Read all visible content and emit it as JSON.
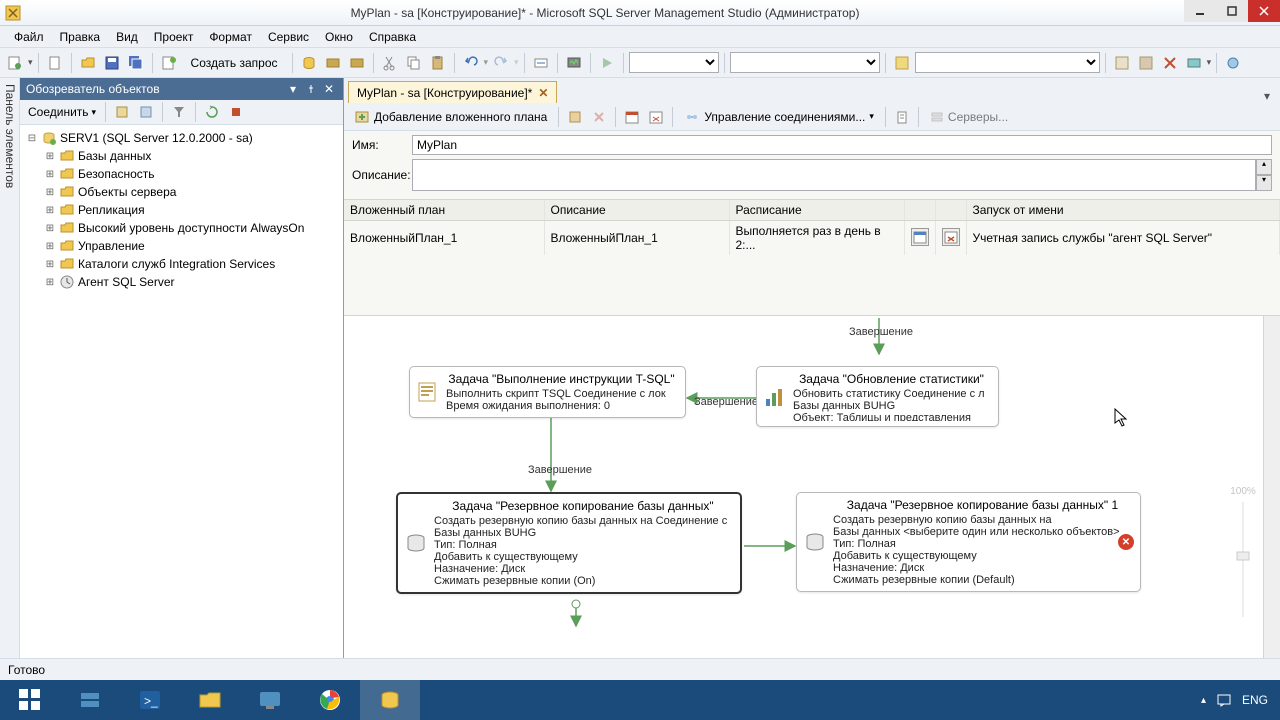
{
  "window": {
    "title": "MyPlan - sa [Конструирование]* - Microsoft SQL Server Management Studio (Администратор)"
  },
  "menu": {
    "items": [
      "Файл",
      "Правка",
      "Вид",
      "Проект",
      "Формат",
      "Сервис",
      "Окно",
      "Справка"
    ]
  },
  "toolbar": {
    "new_query": "Создать запрос"
  },
  "side_tab": "Панель элементов",
  "objexp": {
    "title": "Обозреватель объектов",
    "connect": "Соединить",
    "root": "SERV1 (SQL Server 12.0.2000 - sa)",
    "nodes": [
      "Базы данных",
      "Безопасность",
      "Объекты сервера",
      "Репликация",
      "Высокий уровень доступности AlwaysOn",
      "Управление",
      "Каталоги служб Integration Services",
      "Агент SQL Server"
    ]
  },
  "tab": {
    "label": "MyPlan - sa [Конструирование]*"
  },
  "plan_toolbar": {
    "add_subplan": "Добавление вложенного плана",
    "manage_conn": "Управление соединениями...",
    "servers": "Серверы..."
  },
  "form": {
    "name_label": "Имя:",
    "name_value": "MyPlan",
    "desc_label": "Описание:",
    "desc_value": ""
  },
  "subplan": {
    "headers": {
      "plan": "Вложенный план",
      "desc": "Описание",
      "sched": "Расписание",
      "runas": "Запуск от имени"
    },
    "row": {
      "plan": "ВложенныйПлан_1",
      "desc": "ВложенныйПлан_1",
      "sched": "Выполняется раз в день в 2:...",
      "runas": "Учетная запись службы \"агент SQL Server\""
    }
  },
  "canvas": {
    "completion": "Завершение",
    "task_tsql": {
      "title": "Задача \"Выполнение инструкции T-SQL\"",
      "l1": "Выполнить скрипт TSQL Соединение с лок",
      "l2": "Время ожидания выполнения: 0"
    },
    "task_stats": {
      "title": "Задача \"Обновление статистики\"",
      "l1": "Обновить статистику Соединение с л",
      "l2": "Базы данных BUHG",
      "l3": "Объект: Таблицы и представления"
    },
    "task_backup1": {
      "title": "Задача \"Резервное копирование базы данных\"",
      "l1": "Создать резервную копию базы данных на Соединение с",
      "l2": "Базы данных BUHG",
      "l3": "Тип: Полная",
      "l4": "Добавить к существующему",
      "l5": "Назначение: Диск",
      "l6": "Сжимать резервные копии (On)"
    },
    "task_backup2": {
      "title": "Задача \"Резервное копирование базы данных\" 1",
      "l1": "Создать резервную копию базы данных на",
      "l2": "Базы данных <выберите один или несколько объектов>",
      "l3": "Тип: Полная",
      "l4": "Добавить к существующему",
      "l5": "Назначение: Диск",
      "l6": "Сжимать резервные копии (Default)"
    },
    "zoom": "100%"
  },
  "status": {
    "ready": "Готово"
  },
  "tray": {
    "lang": "ENG"
  }
}
